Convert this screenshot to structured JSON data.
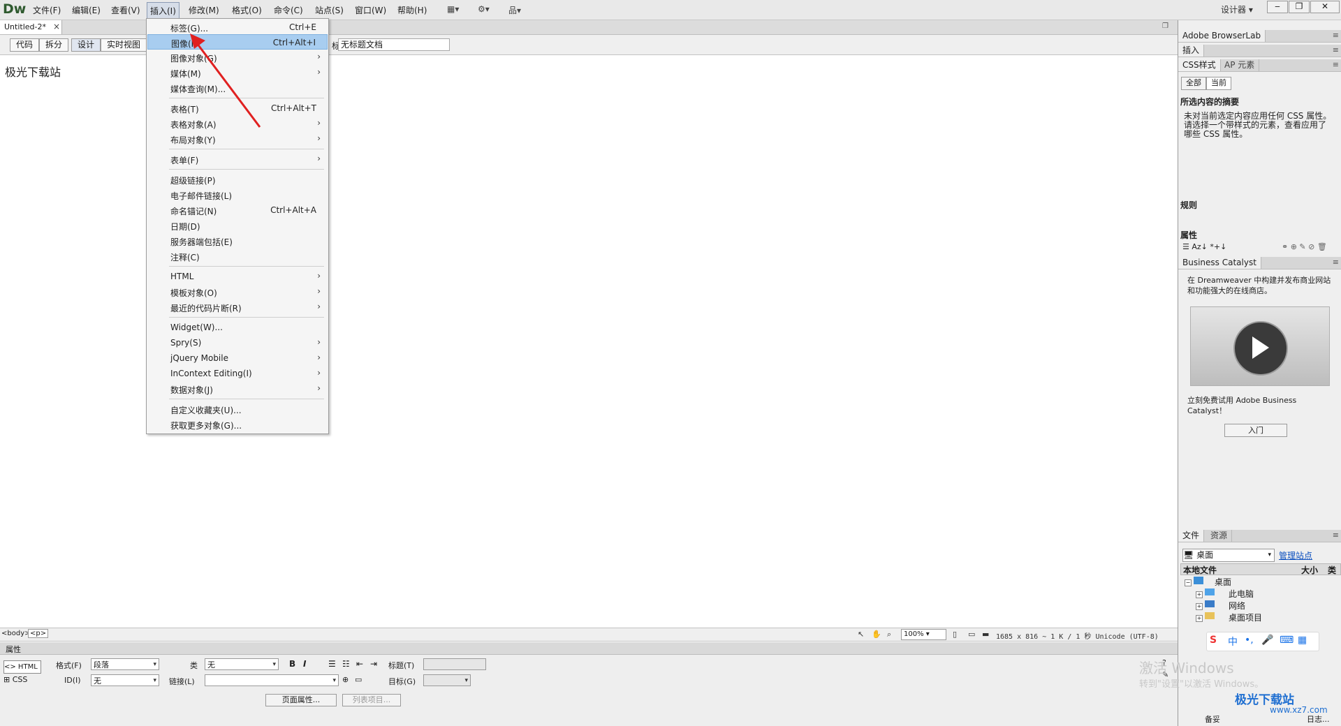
{
  "app": {
    "logo": "Dw",
    "menus": [
      "文件(F)",
      "编辑(E)",
      "查看(V)",
      "插入(I)",
      "修改(M)",
      "格式(O)",
      "命令(C)",
      "站点(S)",
      "窗口(W)",
      "帮助(H)"
    ],
    "workspace": "设计器",
    "win_min": "‒",
    "win_max": "❐",
    "win_close": "✕"
  },
  "document": {
    "tab_label": "Untitled-2*",
    "tab_close": "×",
    "view_buttons": [
      "代码",
      "拆分",
      "设计",
      "实时视图"
    ],
    "title_label": "标题:",
    "title_value": "无标题文档",
    "content_text": "极光下载站"
  },
  "insert_menu": {
    "items": [
      {
        "label": "标签(G)...",
        "shortcut": "Ctrl+E"
      },
      {
        "label": "图像(I)",
        "shortcut": "Ctrl+Alt+I"
      },
      {
        "label": "图像对象(G)",
        "arrow": "›"
      },
      {
        "label": "媒体(M)",
        "arrow": "›"
      },
      {
        "label": "媒体查询(M)..."
      },
      {
        "label": "表格(T)",
        "shortcut": "Ctrl+Alt+T"
      },
      {
        "label": "表格对象(A)",
        "arrow": "›"
      },
      {
        "label": "布局对象(Y)",
        "arrow": "›"
      },
      {
        "label": "表单(F)",
        "arrow": "›"
      },
      {
        "label": "超级链接(P)"
      },
      {
        "label": "电子邮件链接(L)"
      },
      {
        "label": "命名锚记(N)",
        "shortcut": "Ctrl+Alt+A"
      },
      {
        "label": "日期(D)"
      },
      {
        "label": "服务器端包括(E)"
      },
      {
        "label": "注释(C)"
      },
      {
        "label": "HTML",
        "arrow": "›"
      },
      {
        "label": "模板对象(O)",
        "arrow": "›"
      },
      {
        "label": "最近的代码片断(R)",
        "arrow": "›"
      },
      {
        "label": "Widget(W)..."
      },
      {
        "label": "Spry(S)",
        "arrow": "›"
      },
      {
        "label": "jQuery Mobile",
        "arrow": "›"
      },
      {
        "label": "InContext Editing(I)",
        "arrow": "›"
      },
      {
        "label": "数据对象(J)",
        "arrow": "›"
      },
      {
        "label": "自定义收藏夹(U)..."
      },
      {
        "label": "获取更多对象(G)..."
      }
    ]
  },
  "statusbar": {
    "tag_body": "<body>",
    "tag_p": "<p>",
    "zoom": "100%",
    "info": "1685 x 816 ~ 1 K / 1 秒 Unicode (UTF-8)"
  },
  "properties": {
    "header": "属性",
    "html_btn": "<> HTML",
    "css_btn": "CSS",
    "format_label": "格式(F)",
    "format_value": "段落",
    "class_label": "类",
    "class_value": "无",
    "id_label": "ID(I)",
    "id_value": "无",
    "link_label": "链接(L)",
    "link_value": "",
    "title_label": "标题(T)",
    "target_label": "目标(G)",
    "bold": "B",
    "italic": "I",
    "page_props": "页面属性...",
    "list_item": "列表项目..."
  },
  "right_panel": {
    "browserlab": "Adobe BrowserLab",
    "insert_tab": "插入",
    "css_tab": "CSS样式",
    "ap_tab": "AP 元素",
    "all_btn": "全部",
    "current_btn": "当前",
    "summary_title": "所选内容的摘要",
    "summary_text": [
      "未对当前选定内容应用任何 CSS 属性。",
      "请选择一个带样式的元素，查看应用了",
      "哪些 CSS 属性。"
    ],
    "rules_label": "规则",
    "props_label": "属性",
    "bc_title": "Business Catalyst",
    "bc_text1": [
      "在 Dreamweaver 中构建并发布商业网站",
      "和功能强大的在线商店。"
    ],
    "bc_text2": [
      "立刻免费试用 Adobe Business",
      "Catalyst！"
    ],
    "bc_start": "入门",
    "files_tab": "文件",
    "assets_tab": "资源",
    "files_select": "桌面",
    "manage_site": "管理站点",
    "local_files": "本地文件",
    "size": "大小",
    "type": "类",
    "tree": [
      "桌面",
      "此电脑",
      "网络",
      "桌面项目"
    ],
    "ready": "备妥",
    "log": "日志..."
  },
  "ime": {
    "logo": "S",
    "items": [
      "中",
      "•,",
      "🎤",
      "⌨",
      "▦"
    ]
  },
  "watermark": {
    "line1": "激活 Windows",
    "line2": "转到\"设置\"以激活 Windows。"
  },
  "site_logo": {
    "name": "极光下载站",
    "url": "www.xz7.com"
  },
  "colors": {
    "highlight": "#a8cdf0",
    "arrow": "#e02020",
    "link": "#0b4fbf"
  }
}
